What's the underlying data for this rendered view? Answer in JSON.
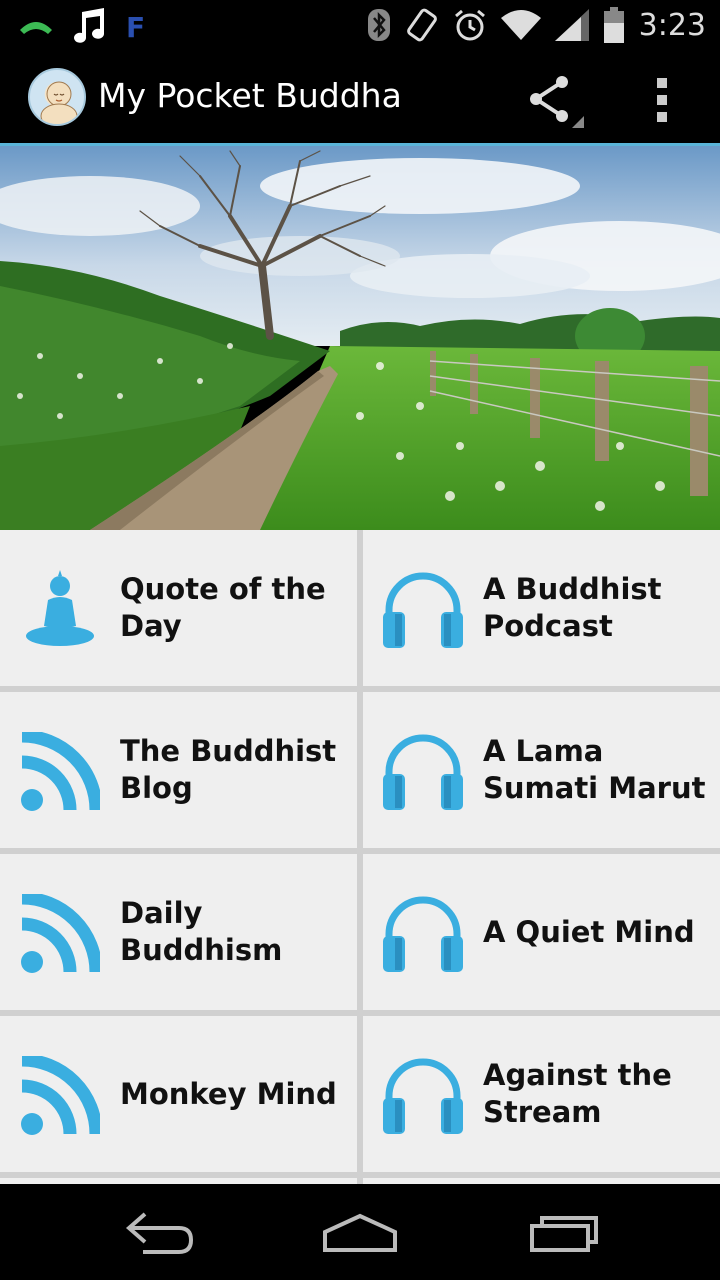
{
  "status_bar": {
    "time": "3:23",
    "icons": [
      "phone-call-icon",
      "music-note-icon",
      "feedly-icon",
      "bluetooth-icon",
      "rotation-icon",
      "alarm-icon",
      "wifi-icon",
      "signal-icon",
      "battery-icon"
    ]
  },
  "action_bar": {
    "title": "My Pocket Buddha",
    "share_icon": "share-icon",
    "overflow_icon": "overflow-menu-icon"
  },
  "hero": {
    "image": "country path along green hedge and fence under cloudy sky"
  },
  "tiles": [
    {
      "label": "Quote of the Day",
      "icon": "buddha-icon"
    },
    {
      "label": "A Buddhist Podcast",
      "icon": "headphones-icon"
    },
    {
      "label": "The Buddhist Blog",
      "icon": "rss-icon"
    },
    {
      "label": "A Lama Sumati Marut",
      "icon": "headphones-icon"
    },
    {
      "label": "Daily Buddhism",
      "icon": "rss-icon"
    },
    {
      "label": "A Quiet Mind",
      "icon": "headphones-icon"
    },
    {
      "label": "Monkey Mind",
      "icon": "rss-icon"
    },
    {
      "label": "Against the Stream",
      "icon": "headphones-icon"
    }
  ],
  "nav_bar": {
    "icons": [
      "back-icon",
      "home-icon",
      "recent-apps-icon"
    ]
  },
  "colors": {
    "accent": "#5ab4d8",
    "icon_blue": "#3aaee0",
    "tile_bg": "#efefef",
    "grid_gap": "#d0d0d0"
  }
}
